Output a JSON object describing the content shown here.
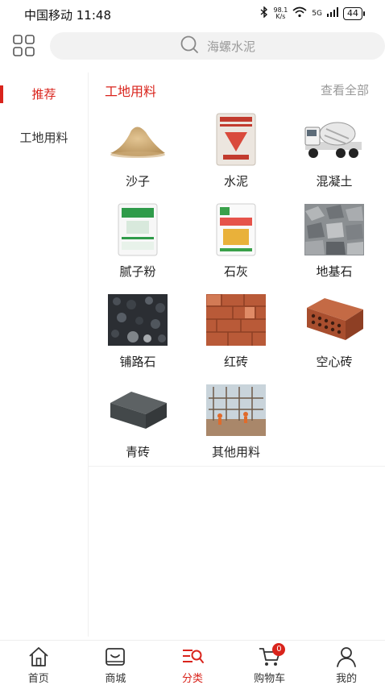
{
  "status": {
    "carrier_time": "中国移动 11:48",
    "net_speed_value": "98.1",
    "net_speed_unit": "K/s",
    "network": "5G",
    "battery": "44"
  },
  "search": {
    "placeholder": "海螺水泥"
  },
  "sidebar": {
    "items": [
      {
        "label": "推荐",
        "active": true
      },
      {
        "label": "工地用料",
        "active": false
      }
    ]
  },
  "section": {
    "title": "工地用料",
    "view_all": "查看全部"
  },
  "products": [
    {
      "label": "沙子",
      "icon": "sand-pile"
    },
    {
      "label": "水泥",
      "icon": "cement-bag"
    },
    {
      "label": "混凝土",
      "icon": "mixer-truck"
    },
    {
      "label": "腻子粉",
      "icon": "putty-bag"
    },
    {
      "label": "石灰",
      "icon": "lime-bag"
    },
    {
      "label": "地基石",
      "icon": "foundation-stones"
    },
    {
      "label": "铺路石",
      "icon": "paving-gravel"
    },
    {
      "label": "红砖",
      "icon": "red-bricks"
    },
    {
      "label": "空心砖",
      "icon": "hollow-brick"
    },
    {
      "label": "青砖",
      "icon": "grey-brick"
    },
    {
      "label": "其他用料",
      "icon": "construction-site"
    }
  ],
  "tabs": [
    {
      "label": "首页",
      "icon": "home-icon"
    },
    {
      "label": "商城",
      "icon": "shop-icon"
    },
    {
      "label": "分类",
      "icon": "category-icon",
      "active": true
    },
    {
      "label": "购物车",
      "icon": "cart-icon",
      "badge": "0"
    },
    {
      "label": "我的",
      "icon": "user-icon"
    }
  ],
  "colors": {
    "accent": "#d9241c",
    "muted": "#999999",
    "search_bg": "#f2f2f2"
  }
}
